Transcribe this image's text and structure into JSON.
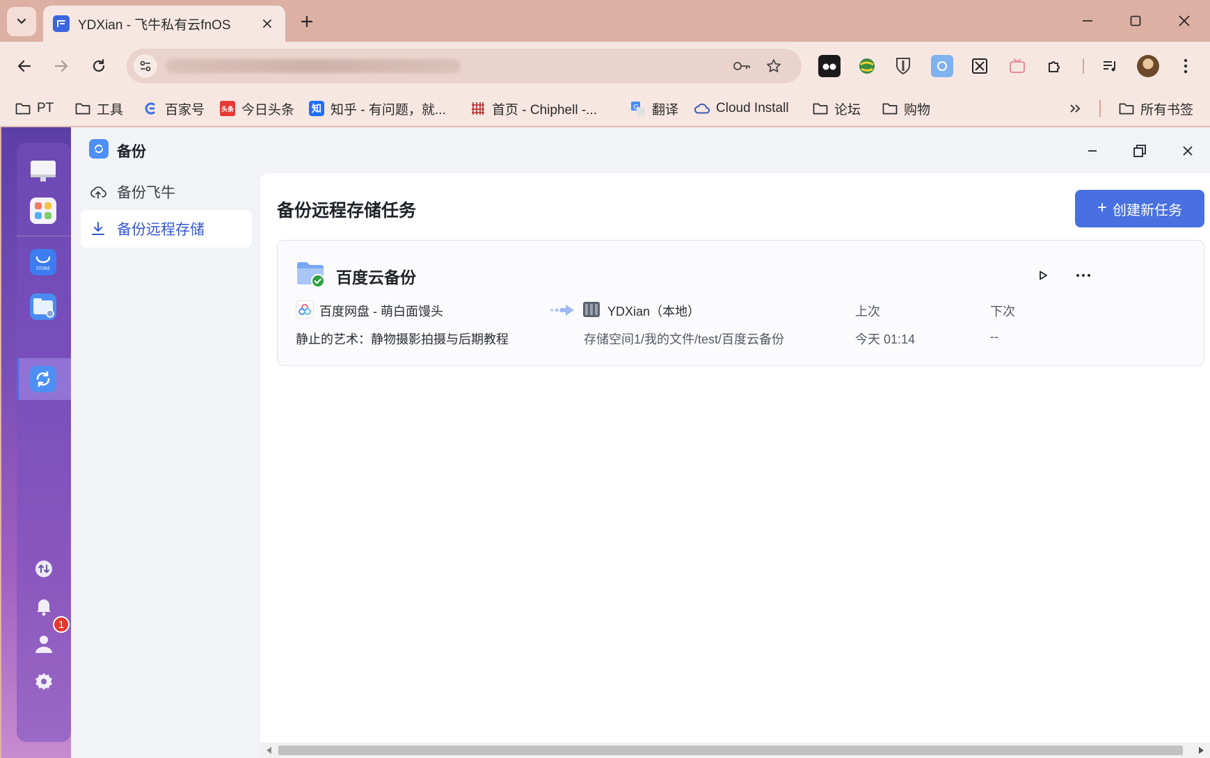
{
  "browser": {
    "tab_title": "YDXian - 飞牛私有云fnOS",
    "bookmarks": [
      {
        "label": "PT",
        "icon": "folder-icon"
      },
      {
        "label": "工具",
        "icon": "folder-icon"
      },
      {
        "label": "百家号",
        "icon": "baijiahao-icon"
      },
      {
        "label": "今日头条",
        "icon": "toutiao-icon"
      },
      {
        "label": "知乎 - 有问题，就...",
        "icon": "zhihu-icon"
      },
      {
        "label": "首页 - Chiphell -...",
        "icon": "chiphell-icon"
      },
      {
        "label": "翻译",
        "icon": "translate-icon"
      },
      {
        "label": "Cloud Install",
        "icon": "cloud-icon"
      },
      {
        "label": "论坛",
        "icon": "folder-icon"
      },
      {
        "label": "购物",
        "icon": "folder-icon"
      }
    ],
    "all_bookmarks": "所有书签",
    "toutiao_badge": "头条",
    "zhihu_badge": "知"
  },
  "dock": {
    "store_label": "STORE",
    "notification_count": "1"
  },
  "app": {
    "title": "备份",
    "sidebar": [
      {
        "label": "备份飞牛",
        "icon": "cloud-upload-icon"
      },
      {
        "label": "备份远程存储",
        "icon": "download-icon",
        "active": true
      }
    ],
    "main_title": "备份远程存储任务",
    "create_button": "创建新任务",
    "task": {
      "name": "百度云备份",
      "source_account": "百度网盘 - 萌白面馒头",
      "source_path": "静止的艺术：静物摄影拍摄与后期教程",
      "destination_device": "YDXian（本地）",
      "destination_path": "存储空间1/我的文件/test/百度云备份",
      "last_label": "上次",
      "last_value": "今天 01:14",
      "next_label": "下次",
      "next_value": "--"
    }
  },
  "colors": {
    "accent": "#4870e0",
    "active_text": "#3557d4",
    "tabstrip": "#dcb0a2",
    "chrome": "#f6e7e2"
  }
}
